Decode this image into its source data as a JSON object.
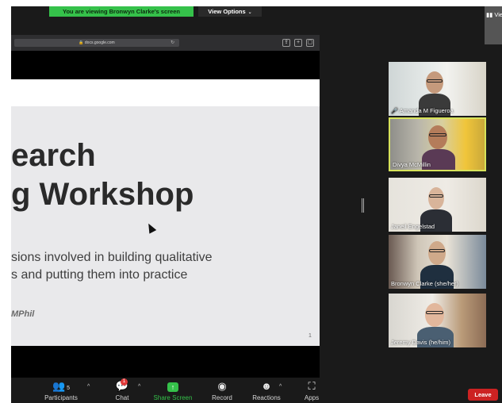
{
  "banner": {
    "viewing_text": "You are viewing Bronwyn Clarke's screen",
    "view_options": "View Options",
    "view_top_right": "View"
  },
  "browser": {
    "url": "docs.google.com"
  },
  "slide": {
    "title_line1": "earch",
    "title_line2": "g Workshop",
    "subtitle_line1": "sions involved in building qualitative",
    "subtitle_line2": "s and putting them into practice",
    "author": "MPhil",
    "page_number": "1"
  },
  "participants": [
    {
      "name": "Amanda M Figueroa",
      "muted": true
    },
    {
      "name": "Divya McMillin",
      "muted": false,
      "active_speaker": true
    },
    {
      "name": "Janeil Engelstad",
      "muted": false
    },
    {
      "name": "Bronwyn Clarke (she/her)",
      "muted": false
    },
    {
      "name": "Jeremy Davis (he/him)",
      "muted": false
    }
  ],
  "toolbar": {
    "participants_label": "Participants",
    "participants_count": "5",
    "chat_label": "Chat",
    "chat_badge": "1",
    "share_label": "Share Screen",
    "record_label": "Record",
    "reactions_label": "Reactions",
    "apps_label": "Apps",
    "leave_label": "Leave"
  },
  "colors": {
    "banner_green": "#35c14a",
    "active_speaker_border": "#d7e35a",
    "leave_red": "#cc2222"
  }
}
